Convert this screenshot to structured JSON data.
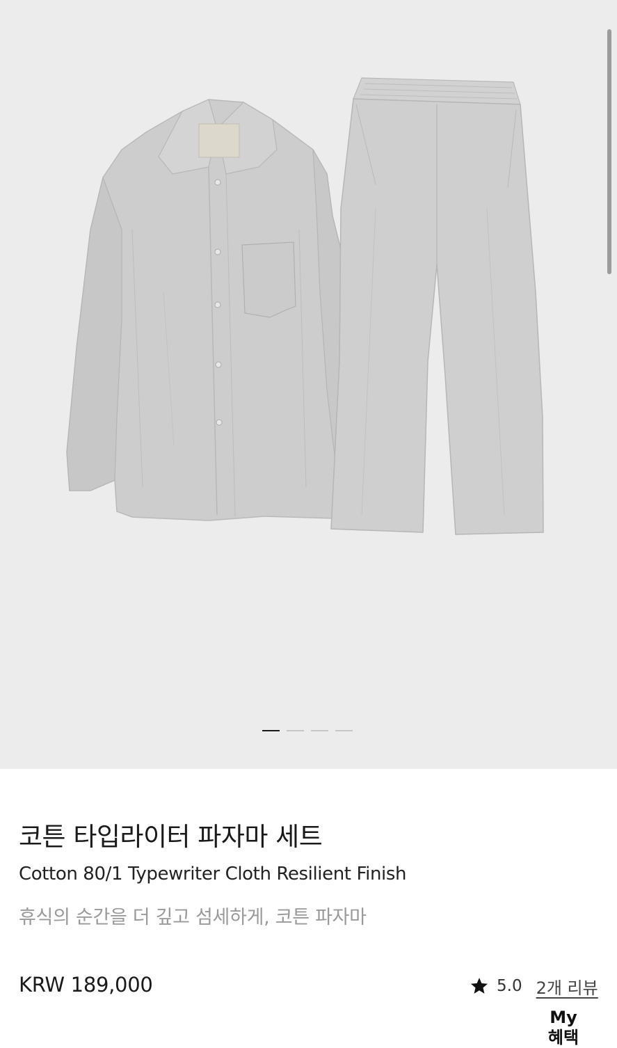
{
  "gallery": {
    "slides_total": 4,
    "active_slide": 1
  },
  "product": {
    "name_ko": "코튼 타입라이터 파자마 세트",
    "name_en": "Cotton 80/1 Typewriter Cloth Resilient Finish",
    "tagline": "휴식의 순간을 더 깊고 섬세하게, 코튼 파자마",
    "price": "KRW 189,000",
    "rating": "5.0",
    "review_link": "2개 리뷰"
  },
  "floating": {
    "benefit_line1": "My",
    "benefit_line2": "혜택"
  },
  "icons": {
    "rating": "star-icon"
  },
  "colors": {
    "gallery_bg": "#ececec",
    "garment": "#cfcfcf",
    "indicator_active": "#1a1a1a",
    "indicator_inactive": "#c6c6c6"
  }
}
